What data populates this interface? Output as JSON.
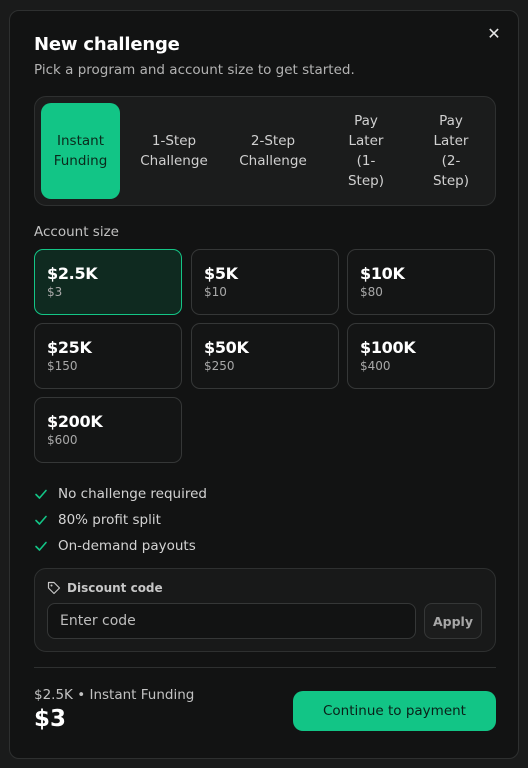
{
  "modal": {
    "title": "New challenge",
    "subtitle": "Pick a program and account size to get started.",
    "close_icon": "close-icon",
    "accent_color": "#12c586"
  },
  "programs": {
    "selected": "Instant Funding",
    "items": [
      {
        "lines": [
          "Instant",
          "Funding"
        ]
      },
      {
        "lines": [
          "1-Step",
          "Challenge"
        ]
      },
      {
        "lines": [
          "2-Step",
          "Challenge"
        ]
      },
      {
        "lines": [
          "Pay",
          "Later",
          "(1-",
          "Step)"
        ]
      },
      {
        "lines": [
          "Pay",
          "Later",
          "(2-",
          "Step)"
        ]
      }
    ]
  },
  "account_size": {
    "label": "Account size",
    "selected": "$2.5K",
    "options": [
      {
        "amount": "$2.5K",
        "price": "$3"
      },
      {
        "amount": "$5K",
        "price": "$10"
      },
      {
        "amount": "$10K",
        "price": "$80"
      },
      {
        "amount": "$25K",
        "price": "$150"
      },
      {
        "amount": "$50K",
        "price": "$250"
      },
      {
        "amount": "$100K",
        "price": "$400"
      },
      {
        "amount": "$200K",
        "price": "$600"
      }
    ]
  },
  "features": [
    {
      "icon": "check-icon",
      "text": "No challenge required"
    },
    {
      "icon": "check-icon",
      "text": "80% profit split"
    },
    {
      "icon": "check-icon",
      "text": "On-demand payouts"
    }
  ],
  "discount": {
    "icon": "tag-icon",
    "label": "Discount code",
    "placeholder": "Enter code",
    "apply_label": "Apply"
  },
  "summary": {
    "selection": "$2.5K • Instant Funding",
    "total": "$3",
    "continue_label": "Continue to payment"
  }
}
